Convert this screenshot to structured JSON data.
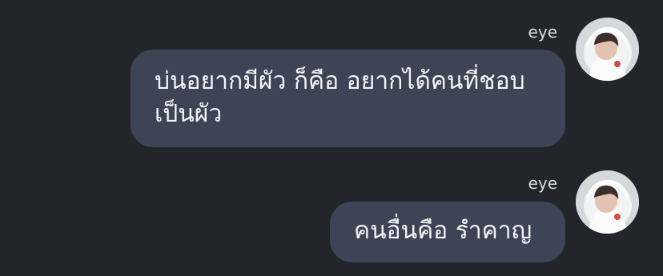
{
  "messages": [
    {
      "sender": "eye",
      "avatar_icon": "profile-photo-white-hoodie",
      "text": "บ่นอยากมีผัว ก็คือ อยากได้คนที่ชอบเป็นผัว"
    },
    {
      "sender": "eye",
      "avatar_icon": "profile-photo-white-hoodie",
      "text": "คนอื่นคือ รำคาญ"
    }
  ],
  "colors": {
    "background": "#23252b",
    "bubble": "#3c4455",
    "bubble_text": "#f4f5f7",
    "sender_text": "#d9dbe0"
  }
}
